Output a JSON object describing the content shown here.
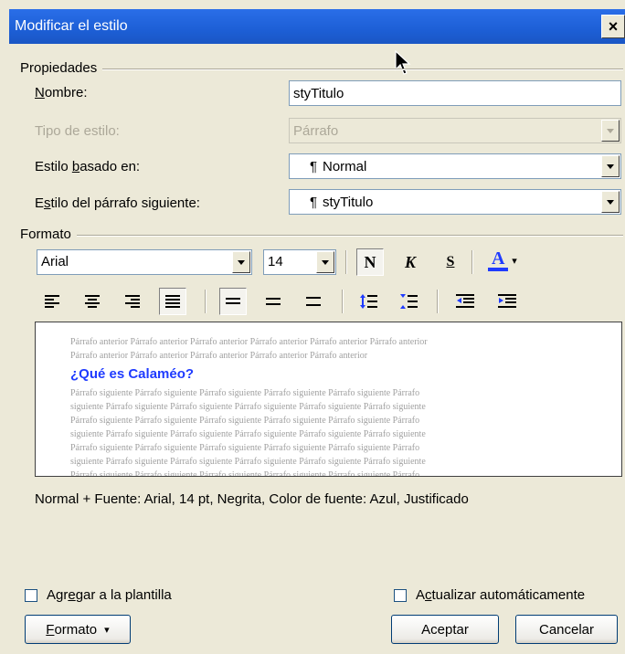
{
  "window": {
    "title": "Modificar el estilo",
    "close_label": "×"
  },
  "properties": {
    "group_label": "Propiedades",
    "name": {
      "label_u": "N",
      "label_rest": "ombre:",
      "value": "styTitulo"
    },
    "style_type": {
      "label": "Tipo de estilo:",
      "value": "Párrafo"
    },
    "based_on": {
      "label_pre": "Estilo ",
      "label_u": "b",
      "label_rest": "asado en:",
      "mark": "¶",
      "value": "Normal"
    },
    "next_style": {
      "label_pre": "E",
      "label_u": "s",
      "label_rest": "tilo del párrafo siguiente:",
      "mark": "¶",
      "value": "styTitulo"
    }
  },
  "format": {
    "group_label": "Formato",
    "font": "Arial",
    "size": "14",
    "bold_glyph": "N",
    "italic_glyph": "K",
    "underline_glyph": "S",
    "color_glyph": "A",
    "color_arrow": "▾",
    "font_color": "#1f3bff"
  },
  "preview": {
    "before_lines": [
      "Párrafo anterior Párrafo anterior Párrafo anterior Párrafo anterior Párrafo anterior Párrafo anterior",
      "Párrafo anterior Párrafo anterior Párrafo anterior Párrafo anterior Párrafo anterior"
    ],
    "heading": "¿Qué es Calaméo?",
    "after_lines": [
      "Párrafo siguiente Párrafo siguiente Párrafo siguiente Párrafo siguiente Párrafo siguiente Párrafo",
      "siguiente Párrafo siguiente Párrafo siguiente Párrafo siguiente Párrafo siguiente Párrafo siguiente",
      "Párrafo siguiente Párrafo siguiente Párrafo siguiente Párrafo siguiente Párrafo siguiente Párrafo",
      "siguiente Párrafo siguiente Párrafo siguiente Párrafo siguiente Párrafo siguiente Párrafo siguiente",
      "Párrafo siguiente Párrafo siguiente Párrafo siguiente Párrafo siguiente Párrafo siguiente Párrafo",
      "siguiente Párrafo siguiente Párrafo siguiente Párrafo siguiente Párrafo siguiente Párrafo siguiente",
      "Párrafo siguiente Párrafo siguiente Párrafo siguiente Párrafo siguiente Párrafo siguiente Párrafo"
    ]
  },
  "description": "Normal + Fuente: Arial, 14 pt, Negrita, Color de fuente: Azul, Justificado",
  "options": {
    "add_to_template": {
      "pre": "Agr",
      "u": "e",
      "rest": "gar a la plantilla",
      "checked": false
    },
    "auto_update": {
      "pre": "A",
      "u": "c",
      "rest": "tualizar automáticamente",
      "checked": false
    }
  },
  "buttons": {
    "format_u": "F",
    "format_rest": "ormato",
    "format_arrow": "▾",
    "accept": "Aceptar",
    "cancel": "Cancelar"
  }
}
